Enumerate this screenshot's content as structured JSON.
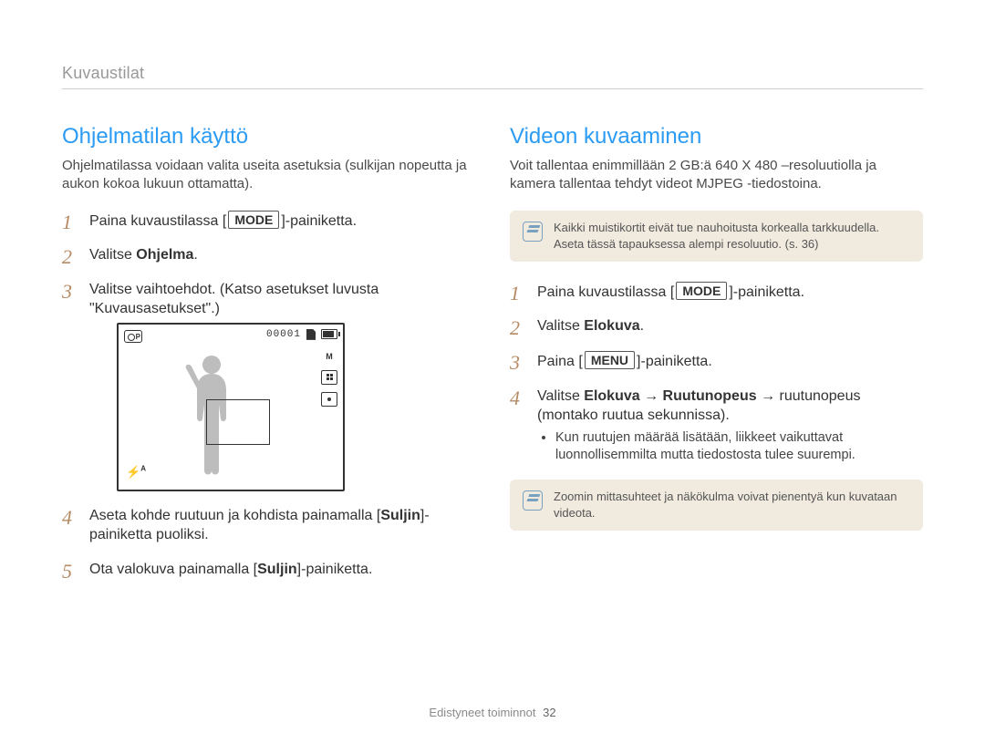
{
  "breadcrumb": "Kuvaustilat",
  "left": {
    "title": "Ohjelmatilan käyttö",
    "intro": "Ohjelmatilassa voidaan valita useita asetuksia (sulkijan nopeutta ja aukon kokoa lukuun ottamatta).",
    "steps": {
      "s1_a": "Paina kuvaustilassa [",
      "s1_mode": "MODE",
      "s1_b": "]-painiketta.",
      "s2_a": "Valitse ",
      "s2_bold": "Ohjelma",
      "s2_b": ".",
      "s3": "Valitse vaihtoehdot. (Katso asetukset luvusta \"Kuvausasetukset\".)",
      "s4_a": "Aseta kohde ruutuun ja kohdista painamalla [",
      "s4_bold": "Suljin",
      "s4_b": "]-painiketta puoliksi.",
      "s5_a": "Ota valokuva painamalla [",
      "s5_bold": "Suljin",
      "s5_b": "]-painiketta."
    },
    "screenshot": {
      "counter": "00001",
      "right_label_1": "M",
      "flash_label": "A"
    }
  },
  "right": {
    "title": "Videon kuvaaminen",
    "intro": "Voit tallentaa enimmillään 2 GB:ä 640 X 480 –resoluutiolla ja kamera tallentaa tehdyt videot MJPEG -tiedostoina.",
    "note1": "Kaikki muistikortit eivät tue nauhoitusta korkealla tarkkuudella. Aseta tässä tapauksessa alempi resoluutio. (s. 36)",
    "steps": {
      "s1_a": "Paina kuvaustilassa [",
      "s1_mode": "MODE",
      "s1_b": "]-painiketta.",
      "s2_a": "Valitse ",
      "s2_bold": "Elokuva",
      "s2_b": ".",
      "s3_a": "Paina [",
      "s3_mode": "MENU",
      "s3_b": "]-painiketta.",
      "s4_a": "Valitse ",
      "s4_bold1": "Elokuva",
      "s4_arrow1": " → ",
      "s4_bold2": "Ruutunopeus",
      "s4_arrow2": " → ",
      "s4_tail": "ruutunopeus (montako ruutua sekunnissa).",
      "s4_bullet": "Kun ruutujen määrää lisätään, liikkeet vaikuttavat luonnollisemmilta mutta tiedostosta tulee suurempi."
    },
    "note2": "Zoomin mittasuhteet ja näkökulma voivat pienentyä kun kuvataan videota."
  },
  "footer": {
    "section": "Edistyneet toiminnot",
    "page": "32"
  }
}
